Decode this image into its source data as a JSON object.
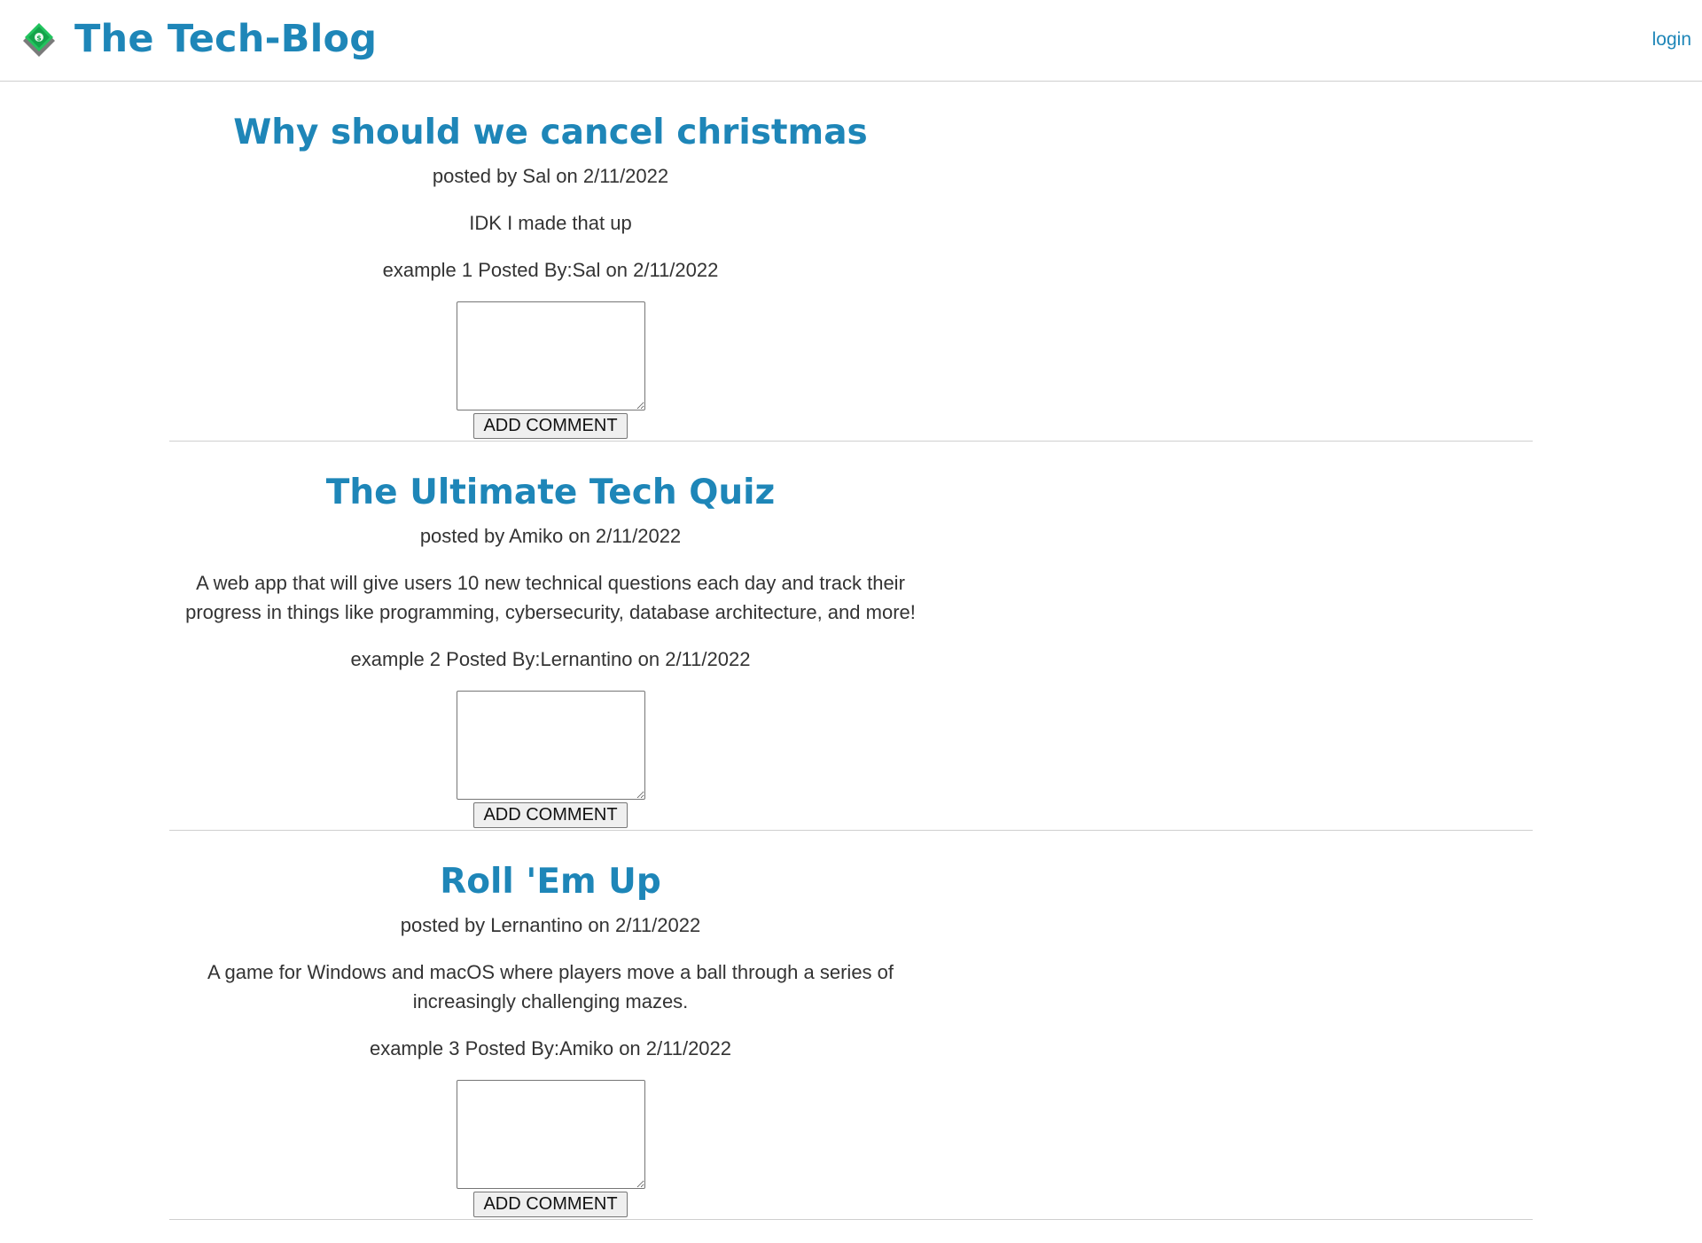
{
  "header": {
    "title": "The Tech-Blog",
    "logo_icon": "money-icon",
    "login_label": "login"
  },
  "colors": {
    "accent": "#1e86b8",
    "text": "#333333",
    "divider": "#cfcfcf"
  },
  "posts": [
    {
      "title": "Why should we cancel christmas",
      "meta": "posted by Sal on 2/11/2022",
      "body": "IDK I made that up",
      "comment": "example 1 Posted By:Sal on 2/11/2022",
      "button_label": "ADD COMMENT"
    },
    {
      "title": "The Ultimate Tech Quiz",
      "meta": "posted by Amiko on 2/11/2022",
      "body": "A web app that will give users 10 new technical questions each day and track their progress in things like programming, cybersecurity, database architecture, and more!",
      "comment": "example 2 Posted By:Lernantino on 2/11/2022",
      "button_label": "ADD COMMENT"
    },
    {
      "title": "Roll 'Em Up",
      "meta": "posted by Lernantino on 2/11/2022",
      "body": "A game for Windows and macOS where players move a ball through a series of increasingly challenging mazes.",
      "comment": "example 3 Posted By:Amiko on 2/11/2022",
      "button_label": "ADD COMMENT"
    }
  ]
}
